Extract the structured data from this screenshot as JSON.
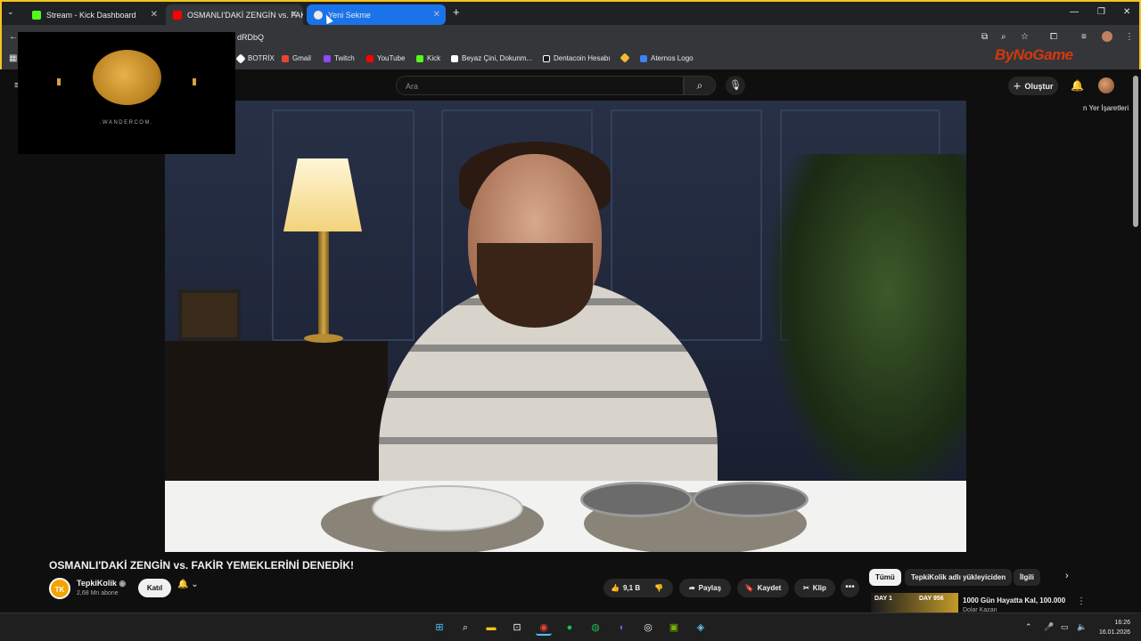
{
  "browser": {
    "tabs": [
      {
        "label": "Stream - Kick Dashboard",
        "fav_color": "#53fc18"
      },
      {
        "label": "OSMANLI'DAKİ ZENGİN vs. FAKİ",
        "fav_color": "#ff0000"
      },
      {
        "label": "Yeni Sekme",
        "fav_color": "#e8eaed"
      }
    ],
    "new_tab": "+",
    "window": {
      "minimize": "—",
      "restore": "❐",
      "close": "✕"
    },
    "url_fragment": "dRDbQ",
    "bookmarks": [
      {
        "label": "BOTRİX",
        "color": "#ffffff"
      },
      {
        "label": "Gmail",
        "color": "#ea4335"
      },
      {
        "label": "Twitch",
        "color": "#9146ff"
      },
      {
        "label": "YouTube",
        "color": "#ff0000"
      },
      {
        "label": "Kick",
        "color": "#53fc18"
      },
      {
        "label": "Beyaz Çini, Dokunm...",
        "color": "#ffffff"
      },
      {
        "label": "Dentacoin Hesabı",
        "color": "#1a1a1a"
      },
      {
        "label": "",
        "color": "#f3ba2f"
      },
      {
        "label": "Aternos Logo",
        "color": "#3b82f6"
      }
    ],
    "bookmarks_right": "n Yer İşaretleri"
  },
  "overlay": {
    "watermark": "ByNoGame",
    "webcam_brand": ".WANDERCOM."
  },
  "youtube": {
    "search_placeholder": "Ara",
    "create_label": "Oluştur",
    "video_title": "OSMANLI'DAKİ ZENGİN vs. FAKİR YEMEKLERİNİ DENEDİK!",
    "channel": {
      "name": "TepkiKolik",
      "subs": "2,68 Mn abone",
      "avatar_text": "TK"
    },
    "join_label": "Katıl",
    "likes": "9,1 B",
    "share_label": "Paylaş",
    "save_label": "Kaydet",
    "clip_label": "Klip",
    "more_label": "•••",
    "chips": [
      "Tümü",
      "TepkiKolik adlı yükleyiciden",
      "İlgili"
    ],
    "suggested": {
      "thumb_left": "DAY 1",
      "thumb_right": "DAY 956",
      "title": "1000 Gün Hayatta Kal, 100.000",
      "subtitle": "Dolar Kazan"
    }
  },
  "taskbar": {
    "time": "16:26",
    "date": "16.01.2026"
  }
}
